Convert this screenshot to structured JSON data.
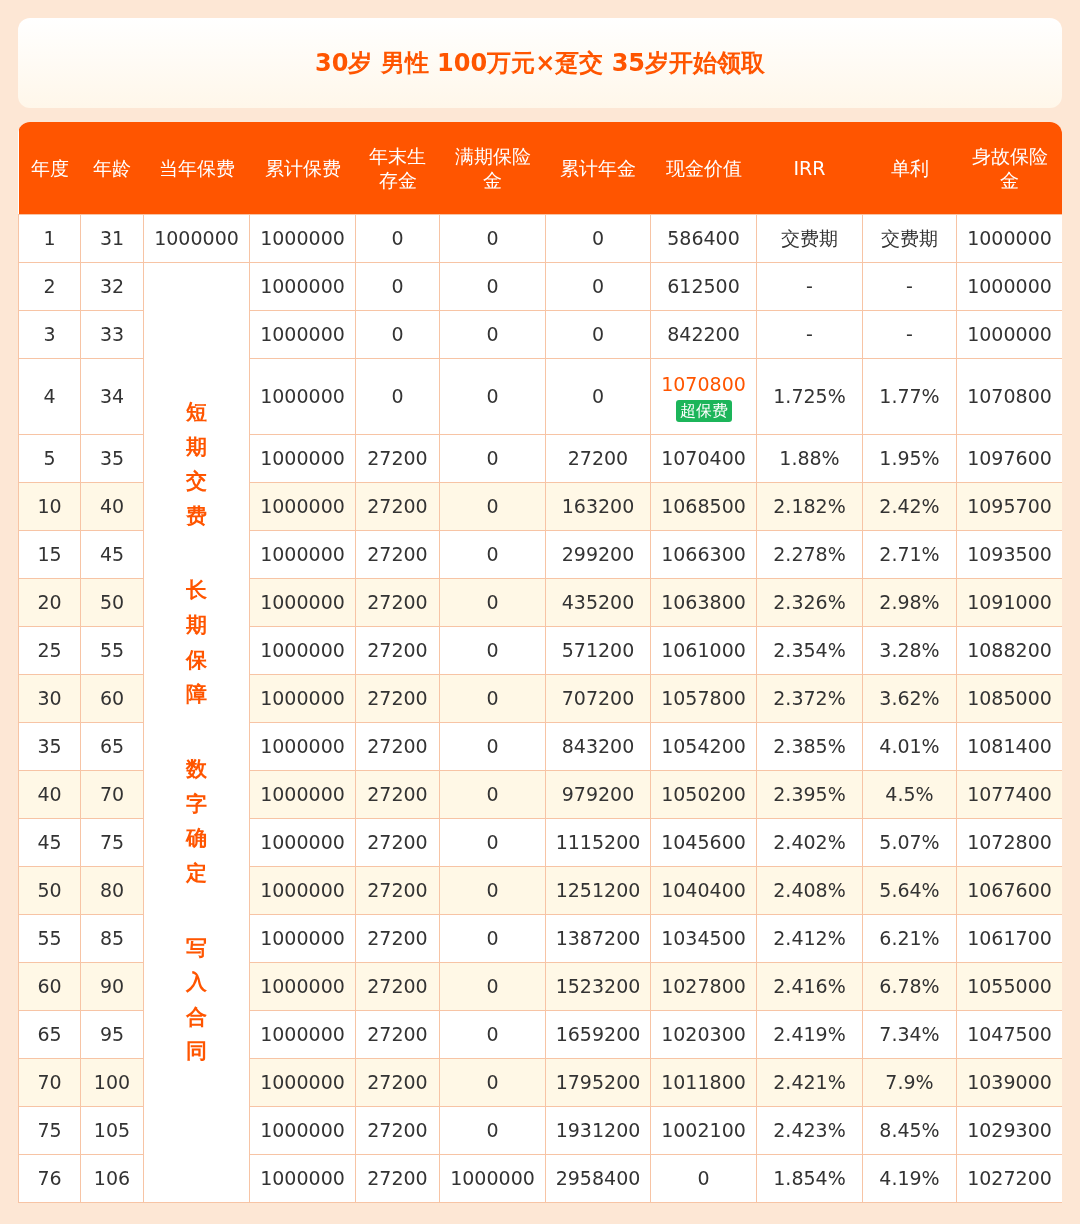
{
  "title": "30岁 男性 100万元×趸交 35岁开始领取",
  "columns": [
    "年度",
    "年龄",
    "当年保费",
    "累计保费",
    "年末生存金",
    "满期保险金",
    "累计年金",
    "现金价值",
    "IRR",
    "单利",
    "身故保险金"
  ],
  "merged_note": [
    "短期交费",
    "长期保障",
    "数字确定",
    "写入合同"
  ],
  "rows": [
    {
      "shaded": false,
      "cells": [
        "1",
        "31",
        "1000000",
        "1000000",
        "0",
        "0",
        "0",
        "586400",
        "交费期",
        "交费期",
        "1000000"
      ]
    },
    {
      "shaded": false,
      "cells": [
        "2",
        "32",
        "1000000",
        "0",
        "0",
        "0",
        "612500",
        "-",
        "-",
        "1000000"
      ]
    },
    {
      "shaded": false,
      "cells": [
        "3",
        "33",
        "1000000",
        "0",
        "0",
        "0",
        "842200",
        "-",
        "-",
        "1000000"
      ]
    },
    {
      "shaded": false,
      "cells": [
        "4",
        "34",
        "1000000",
        "0",
        "0",
        "0",
        "1070800",
        "1.725%",
        "1.77%",
        "1070800"
      ],
      "cash_highlight": true,
      "cash_badge": "超保费"
    },
    {
      "shaded": false,
      "cells": [
        "5",
        "35",
        "1000000",
        "27200",
        "0",
        "27200",
        "1070400",
        "1.88%",
        "1.95%",
        "1097600"
      ]
    },
    {
      "shaded": true,
      "cells": [
        "10",
        "40",
        "1000000",
        "27200",
        "0",
        "163200",
        "1068500",
        "2.182%",
        "2.42%",
        "1095700"
      ]
    },
    {
      "shaded": false,
      "cells": [
        "15",
        "45",
        "1000000",
        "27200",
        "0",
        "299200",
        "1066300",
        "2.278%",
        "2.71%",
        "1093500"
      ]
    },
    {
      "shaded": true,
      "cells": [
        "20",
        "50",
        "1000000",
        "27200",
        "0",
        "435200",
        "1063800",
        "2.326%",
        "2.98%",
        "1091000"
      ]
    },
    {
      "shaded": false,
      "cells": [
        "25",
        "55",
        "1000000",
        "27200",
        "0",
        "571200",
        "1061000",
        "2.354%",
        "3.28%",
        "1088200"
      ]
    },
    {
      "shaded": true,
      "cells": [
        "30",
        "60",
        "1000000",
        "27200",
        "0",
        "707200",
        "1057800",
        "2.372%",
        "3.62%",
        "1085000"
      ]
    },
    {
      "shaded": false,
      "cells": [
        "35",
        "65",
        "1000000",
        "27200",
        "0",
        "843200",
        "1054200",
        "2.385%",
        "4.01%",
        "1081400"
      ]
    },
    {
      "shaded": true,
      "cells": [
        "40",
        "70",
        "1000000",
        "27200",
        "0",
        "979200",
        "1050200",
        "2.395%",
        "4.5%",
        "1077400"
      ]
    },
    {
      "shaded": false,
      "cells": [
        "45",
        "75",
        "1000000",
        "27200",
        "0",
        "1115200",
        "1045600",
        "2.402%",
        "5.07%",
        "1072800"
      ]
    },
    {
      "shaded": true,
      "cells": [
        "50",
        "80",
        "1000000",
        "27200",
        "0",
        "1251200",
        "1040400",
        "2.408%",
        "5.64%",
        "1067600"
      ]
    },
    {
      "shaded": false,
      "cells": [
        "55",
        "85",
        "1000000",
        "27200",
        "0",
        "1387200",
        "1034500",
        "2.412%",
        "6.21%",
        "1061700"
      ]
    },
    {
      "shaded": true,
      "cells": [
        "60",
        "90",
        "1000000",
        "27200",
        "0",
        "1523200",
        "1027800",
        "2.416%",
        "6.78%",
        "1055000"
      ]
    },
    {
      "shaded": false,
      "cells": [
        "65",
        "95",
        "1000000",
        "27200",
        "0",
        "1659200",
        "1020300",
        "2.419%",
        "7.34%",
        "1047500"
      ]
    },
    {
      "shaded": true,
      "cells": [
        "70",
        "100",
        "1000000",
        "27200",
        "0",
        "1795200",
        "1011800",
        "2.421%",
        "7.9%",
        "1039000"
      ]
    },
    {
      "shaded": false,
      "cells": [
        "75",
        "105",
        "1000000",
        "27200",
        "0",
        "1931200",
        "1002100",
        "2.423%",
        "8.45%",
        "1029300"
      ]
    },
    {
      "shaded": false,
      "cells": [
        "76",
        "106",
        "1000000",
        "27200",
        "1000000",
        "2958400",
        "0",
        "1.854%",
        "4.19%",
        "1027200"
      ]
    }
  ]
}
